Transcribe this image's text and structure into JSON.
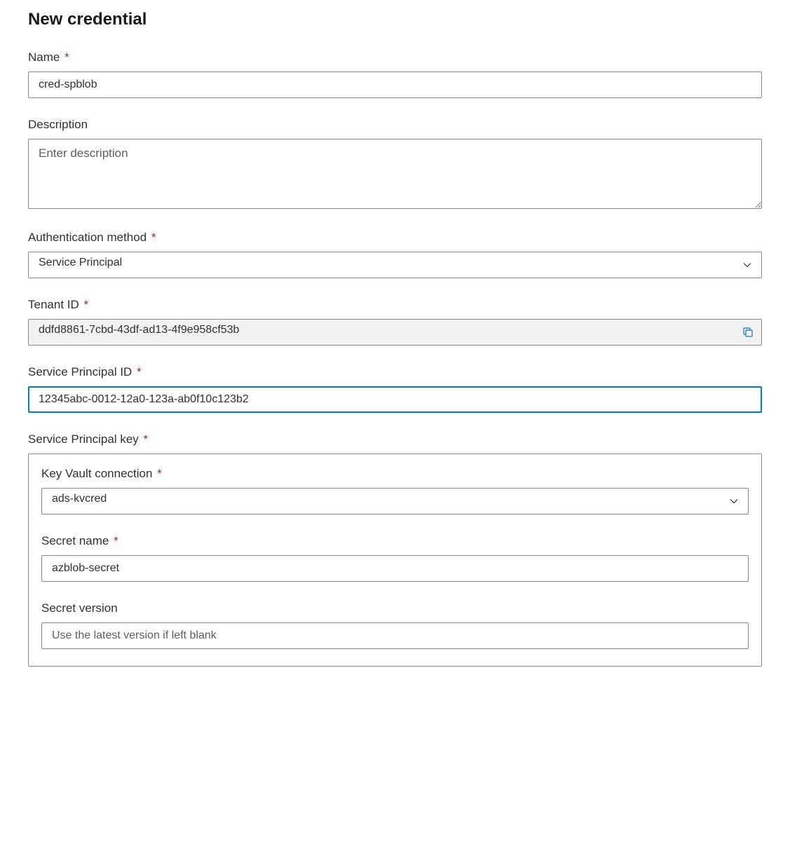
{
  "page": {
    "title": "New credential"
  },
  "fields": {
    "name": {
      "label": "Name",
      "value": "cred-spblob",
      "required": true
    },
    "description": {
      "label": "Description",
      "placeholder": "Enter description",
      "value": ""
    },
    "auth_method": {
      "label": "Authentication method",
      "value": "Service Principal",
      "required": true
    },
    "tenant_id": {
      "label": "Tenant ID",
      "value": "ddfd8861-7cbd-43df-ad13-4f9e958cf53b",
      "required": true
    },
    "sp_id": {
      "label": "Service Principal ID",
      "value": "12345abc-0012-12a0-123a-ab0f10c123b2",
      "required": true
    },
    "sp_key": {
      "label": "Service Principal key",
      "required": true,
      "kv_connection": {
        "label": "Key Vault connection",
        "value": "ads-kvcred",
        "required": true
      },
      "secret_name": {
        "label": "Secret name",
        "value": "azblob-secret",
        "required": true
      },
      "secret_version": {
        "label": "Secret version",
        "placeholder": "Use the latest version if left blank",
        "value": ""
      }
    }
  }
}
